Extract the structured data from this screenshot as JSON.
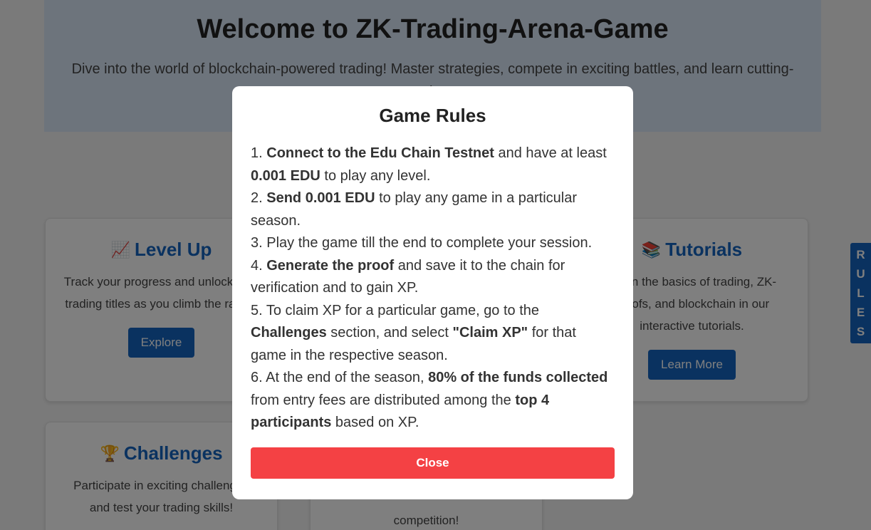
{
  "hero": {
    "title": "Welcome to ZK-Trading-Arena-Game",
    "subtitle": "Dive into the world of blockchain-powered trading! Master strategies, compete in exciting battles, and learn cutting-edge"
  },
  "cards": [
    {
      "emoji": "📈",
      "title": "Level Up",
      "desc": "Track your progress and unlock new trading titles as you climb the ranks!",
      "button": "Explore"
    },
    {
      "emoji": "📚",
      "title": "Tutorials",
      "desc": "Learn the basics of trading, ZK-proofs, and blockchain in our interactive tutorials.",
      "button": "Learn More"
    },
    {
      "emoji": "🏆",
      "title": "Challenges",
      "desc": "Participate in exciting challenges and test your trading skills!"
    },
    {
      "desc": "competition!"
    }
  ],
  "rules_tab": [
    "R",
    "U",
    "L",
    "E",
    "S"
  ],
  "modal": {
    "title": "Game Rules",
    "rules": [
      [
        {
          "t": "1. "
        },
        {
          "t": "Connect to the Edu Chain Testnet",
          "b": true
        },
        {
          "t": " and have at least "
        },
        {
          "t": "0.001 EDU",
          "b": true
        },
        {
          "t": " to play any level."
        }
      ],
      [
        {
          "t": "2. "
        },
        {
          "t": "Send 0.001 EDU",
          "b": true
        },
        {
          "t": " to play any game in a particular season."
        }
      ],
      [
        {
          "t": "3. Play the game till the end to complete your session."
        }
      ],
      [
        {
          "t": "4. "
        },
        {
          "t": "Generate the proof",
          "b": true
        },
        {
          "t": " and save it to the chain for verification and to gain XP."
        }
      ],
      [
        {
          "t": "5. To claim XP for a particular game, go to the "
        },
        {
          "t": "Challenges",
          "b": true
        },
        {
          "t": " section, and select "
        },
        {
          "t": "\"Claim XP\"",
          "b": true
        },
        {
          "t": " for that game in the respective season."
        }
      ],
      [
        {
          "t": "6. At the end of the season, "
        },
        {
          "t": "80% of the funds collected",
          "b": true
        },
        {
          "t": " from entry fees are distributed among the "
        },
        {
          "t": "top 4 participants",
          "b": true
        },
        {
          "t": " based on XP."
        }
      ]
    ],
    "close_label": "Close"
  }
}
